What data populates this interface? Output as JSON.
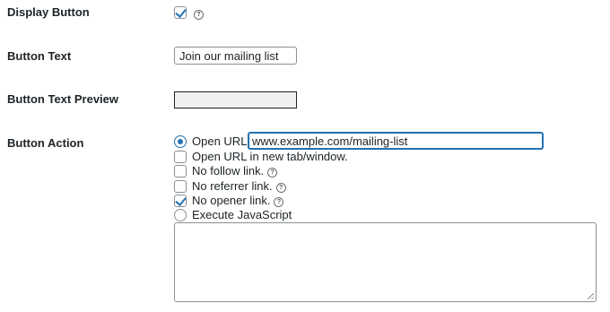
{
  "display_button": {
    "label": "Display Button",
    "checked": true,
    "help": "?"
  },
  "button_text": {
    "label": "Button Text",
    "value": "Join our mailing list"
  },
  "button_text_preview": {
    "label": "Button Text Preview"
  },
  "button_action": {
    "label": "Button Action",
    "open_url": {
      "label": "Open URL:",
      "selected": true,
      "value": "www.example.com/mailing-list"
    },
    "new_tab": {
      "label": "Open URL in new tab/window.",
      "checked": false
    },
    "no_follow": {
      "label": "No follow link.",
      "checked": false,
      "help": "?"
    },
    "no_referrer": {
      "label": "No referrer link.",
      "checked": false,
      "help": "?"
    },
    "no_opener": {
      "label": "No opener link.",
      "checked": true,
      "help": "?"
    },
    "execute_js": {
      "label": "Execute JavaScript",
      "selected": false,
      "value": ""
    }
  },
  "colors": {
    "accent": "#2271b1",
    "border": "#8c8f94",
    "text": "#1d2327"
  }
}
